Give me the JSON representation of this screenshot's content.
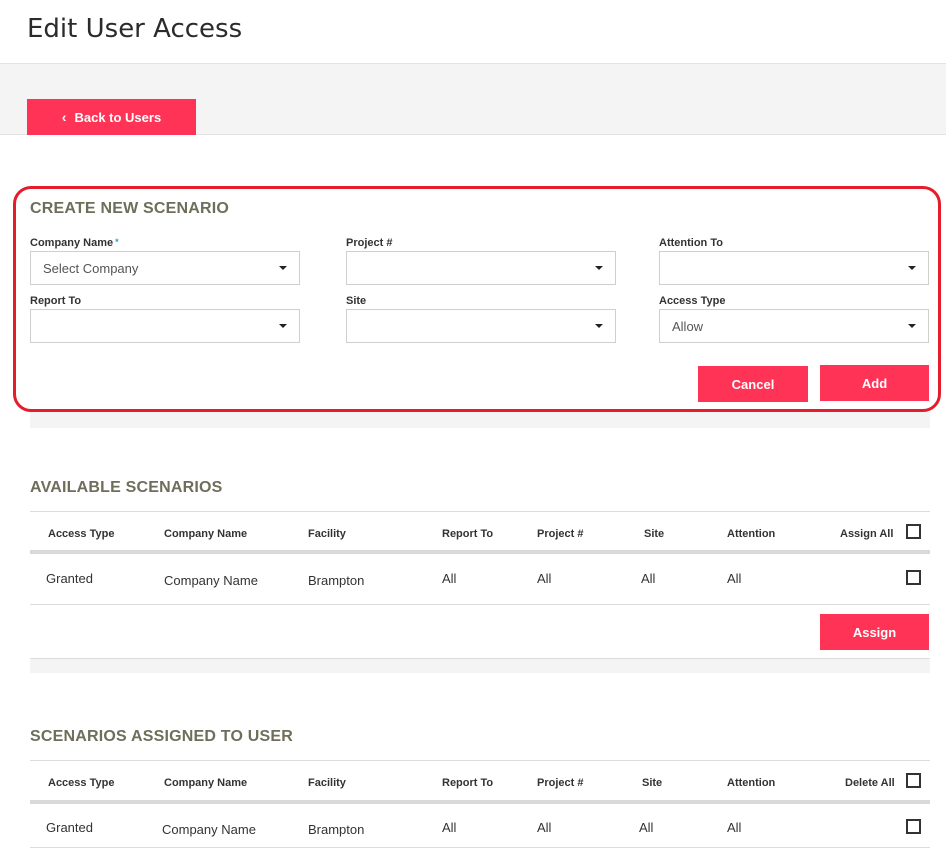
{
  "page": {
    "title": "Edit User Access"
  },
  "nav": {
    "back_label": "Back to Users"
  },
  "create": {
    "title": "CREATE NEW SCENARIO",
    "fields": {
      "company_name": {
        "label": "Company Name",
        "required": "*",
        "value": "Select Company"
      },
      "project": {
        "label": "Project #",
        "value": ""
      },
      "attention_to": {
        "label": "Attention To",
        "value": ""
      },
      "report_to": {
        "label": "Report To",
        "value": ""
      },
      "site": {
        "label": "Site",
        "value": ""
      },
      "access_type": {
        "label": "Access Type",
        "value": "Allow"
      }
    },
    "cancel_label": "Cancel",
    "add_label": "Add"
  },
  "available": {
    "title": "AVAILABLE SCENARIOS",
    "columns": [
      "Access Type",
      "Company Name",
      "Facility",
      "Report To",
      "Project #",
      "Site",
      "Attention",
      "Assign All"
    ],
    "rows": [
      [
        "Granted",
        "Company Name",
        "Brampton",
        "All",
        "All",
        "All",
        "All"
      ]
    ],
    "assign_label": "Assign"
  },
  "assigned": {
    "title": "SCENARIOS ASSIGNED TO USER",
    "columns": [
      "Access Type",
      "Company Name",
      "Facility",
      "Report To",
      "Project #",
      "Site",
      "Attention",
      "Delete All"
    ],
    "rows": [
      [
        "Granted",
        "Company Name",
        "Brampton",
        "All",
        "All",
        "All",
        "All"
      ]
    ]
  },
  "colors": {
    "accent": "#ff3355",
    "highlight_border": "#e51c2b",
    "section_title": "#6e6e5a"
  },
  "icons": {
    "back": "chevron-left-icon",
    "dropdown": "caret-down-icon"
  }
}
